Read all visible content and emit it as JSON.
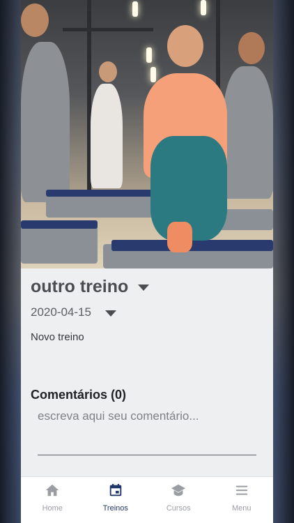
{
  "workout": {
    "title": "outro treino",
    "date": "2020-04-15",
    "description": "Novo treino"
  },
  "comments": {
    "heading": "Comentários (0)",
    "placeholder": "escreva aqui seu comentário..."
  },
  "tabbar": {
    "tabs": [
      {
        "label": "Home",
        "icon": "home-icon",
        "active": false
      },
      {
        "label": "Treinos",
        "icon": "calendar-icon",
        "active": true
      },
      {
        "label": "Cursos",
        "icon": "graduation-cap-icon",
        "active": false
      },
      {
        "label": "Menu",
        "icon": "hamburger-menu-icon",
        "active": false
      }
    ]
  },
  "colors": {
    "active_tab": "#1f3566",
    "inactive_tab": "#9a9da3",
    "title": "#4a4d52"
  }
}
